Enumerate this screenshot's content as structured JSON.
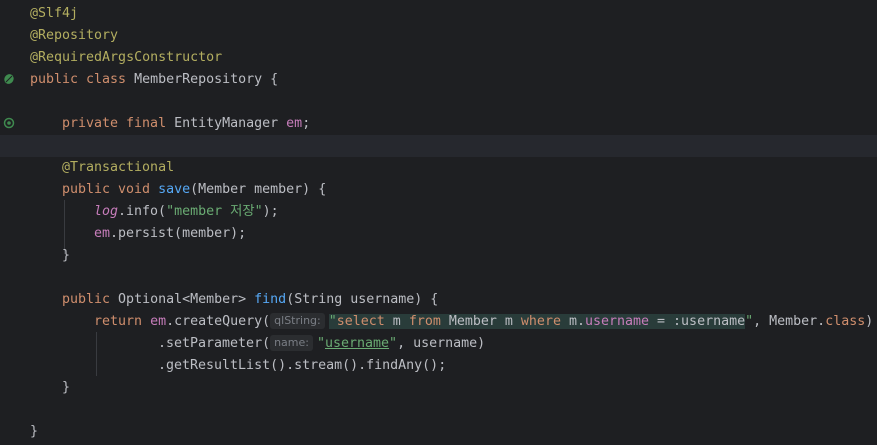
{
  "lines": {
    "l1": "@Slf4j",
    "l2": "@Repository",
    "l3": "@RequiredArgsConstructor",
    "l4_kw": "public class",
    "l4_rest": " MemberRepository {",
    "l5_kw": "private final",
    "l5_type": " EntityManager ",
    "l5_var": "em",
    "l5_end": ";",
    "l6_ann": "@Transactional",
    "l7_kw": "public void",
    "l7_fn": "save",
    "l7_rest": "(Member member) {",
    "l8_log": "log",
    "l8_call": ".info(",
    "l8_str": "\"member 저장\"",
    "l8_end": ");",
    "l9_em": "em",
    "l9_rest": ".persist(member);",
    "l10": "}",
    "l11_kw": "public",
    "l11_type": " Optional<Member> ",
    "l11_fn": "find",
    "l11_rest": "(String username) {",
    "l12_kw": "return",
    "l12_em": "em",
    "l12_call": ".createQuery(",
    "l12_hint": "qlString:",
    "l12_q1": "\"",
    "l12_sel": "select",
    "l12_q2": " m ",
    "l12_from": "from",
    "l12_q3": " Member m ",
    "l12_where": "where",
    "l12_q4": " m.",
    "l12_uname": "username",
    "l12_q5": " = :username",
    "l12_q6": "\"",
    "l12_rest": ", Member.",
    "l12_class": "class",
    "l12_end": ")",
    "l13_call": ".setParameter(",
    "l13_hint": "name:",
    "l13_q": "\"",
    "l13_str": "username",
    "l13_q2": "\"",
    "l13_rest": ", username)",
    "l14": ".getResultList().stream().findAny();",
    "l15": "}",
    "l16": "}"
  }
}
